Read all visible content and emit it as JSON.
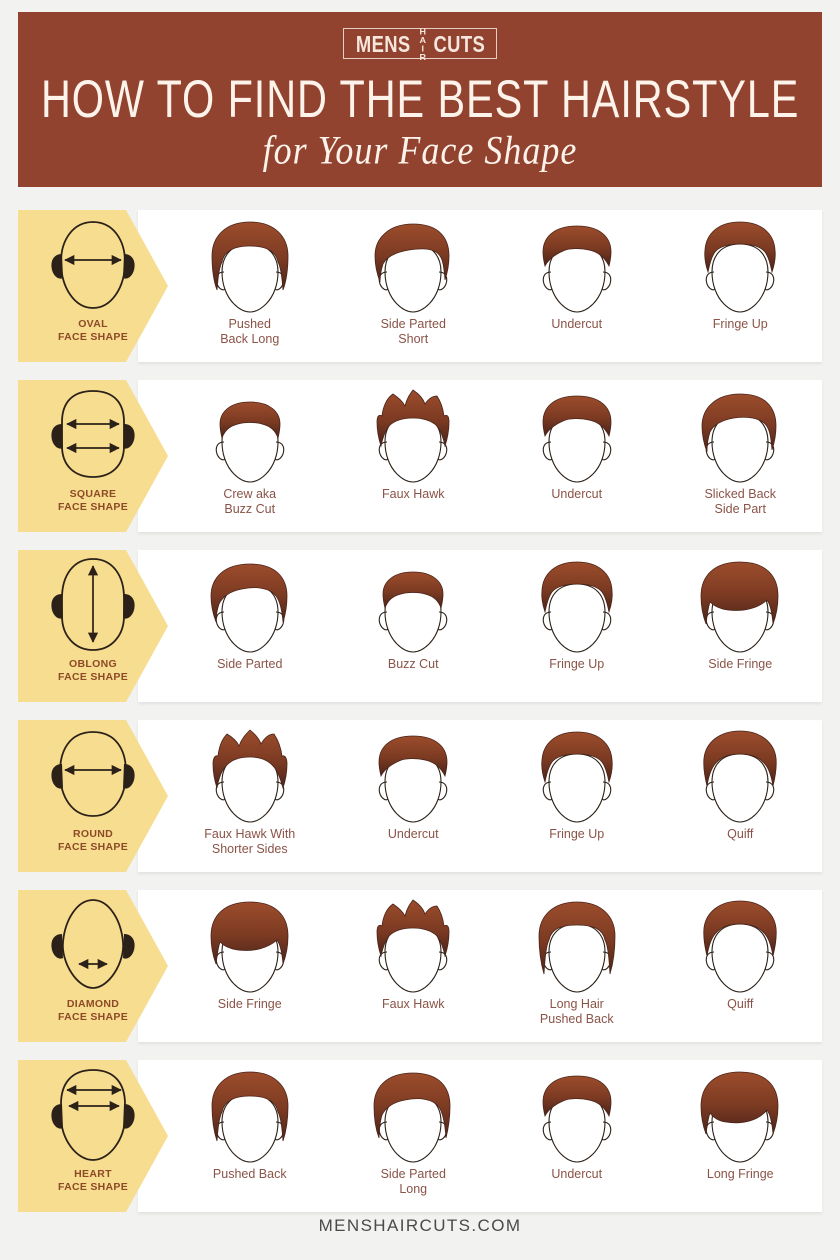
{
  "header": {
    "logo": {
      "word1": "MENS",
      "vertical": "HAIR",
      "word2": "CUTS"
    },
    "title_main": "HOW TO FIND THE BEST HAIRSTYLE",
    "title_sub": "for Your Face Shape",
    "bg_color": "#91432f",
    "text_color": "#fdf3ea"
  },
  "colors": {
    "page_bg": "#f2f2f0",
    "card_yellow": "#f7dd90",
    "row_white": "#ffffff",
    "label_brown": "#8d4a27",
    "style_label": "#8a5347",
    "hair_dark": "#4a241a",
    "hair_mid": "#7b3a22",
    "hair_light": "#9c4d2c",
    "outline": "#2b2118"
  },
  "rows": [
    {
      "shape_name": "OVAL",
      "shape_sub": "FACE SHAPE",
      "shape_icon": "oval-face-icon",
      "arrows": "one-horizontal-middle",
      "styles": [
        {
          "label": "Pushed\nBack Long",
          "icon": "hairstyle-pushed-back-long"
        },
        {
          "label": "Side Parted\nShort",
          "icon": "hairstyle-side-parted-short"
        },
        {
          "label": "Undercut",
          "icon": "hairstyle-undercut"
        },
        {
          "label": "Fringe Up",
          "icon": "hairstyle-fringe-up"
        }
      ]
    },
    {
      "shape_name": "SQUARE",
      "shape_sub": "FACE SHAPE",
      "shape_icon": "square-face-icon",
      "arrows": "two-horizontal",
      "styles": [
        {
          "label": "Crew aka\nBuzz Cut",
          "icon": "hairstyle-crew-buzz-cut"
        },
        {
          "label": "Faux Hawk",
          "icon": "hairstyle-faux-hawk"
        },
        {
          "label": "Undercut",
          "icon": "hairstyle-undercut"
        },
        {
          "label": "Slicked Back\nSide Part",
          "icon": "hairstyle-slicked-back-side-part"
        }
      ]
    },
    {
      "shape_name": "OBLONG",
      "shape_sub": "FACE SHAPE",
      "shape_icon": "oblong-face-icon",
      "arrows": "one-vertical",
      "styles": [
        {
          "label": "Side Parted",
          "icon": "hairstyle-side-parted"
        },
        {
          "label": "Buzz Cut",
          "icon": "hairstyle-buzz-cut"
        },
        {
          "label": "Fringe Up",
          "icon": "hairstyle-fringe-up"
        },
        {
          "label": "Side Fringe",
          "icon": "hairstyle-side-fringe"
        }
      ]
    },
    {
      "shape_name": "ROUND",
      "shape_sub": "FACE SHAPE",
      "shape_icon": "round-face-icon",
      "arrows": "one-horizontal-middle",
      "styles": [
        {
          "label": "Faux Hawk With\nShorter Sides",
          "icon": "hairstyle-faux-hawk-shorter-sides"
        },
        {
          "label": "Undercut",
          "icon": "hairstyle-undercut"
        },
        {
          "label": "Fringe Up",
          "icon": "hairstyle-fringe-up"
        },
        {
          "label": "Quiff",
          "icon": "hairstyle-quiff"
        }
      ]
    },
    {
      "shape_name": "DIAMOND",
      "shape_sub": "FACE SHAPE",
      "shape_icon": "diamond-face-icon",
      "arrows": "one-short-horizontal-low",
      "styles": [
        {
          "label": "Side Fringe",
          "icon": "hairstyle-side-fringe"
        },
        {
          "label": "Faux Hawk",
          "icon": "hairstyle-faux-hawk"
        },
        {
          "label": "Long Hair\nPushed Back",
          "icon": "hairstyle-long-hair-pushed-back"
        },
        {
          "label": "Quiff",
          "icon": "hairstyle-quiff"
        }
      ]
    },
    {
      "shape_name": "HEART",
      "shape_sub": "FACE SHAPE",
      "shape_icon": "heart-face-icon",
      "arrows": "two-horizontal-upper",
      "styles": [
        {
          "label": "Pushed Back",
          "icon": "hairstyle-pushed-back"
        },
        {
          "label": "Side Parted\nLong",
          "icon": "hairstyle-side-parted-long"
        },
        {
          "label": "Undercut",
          "icon": "hairstyle-undercut"
        },
        {
          "label": "Long Fringe",
          "icon": "hairstyle-long-fringe"
        }
      ]
    }
  ],
  "footer": {
    "site": "MENSHAIRCUTS.COM"
  }
}
